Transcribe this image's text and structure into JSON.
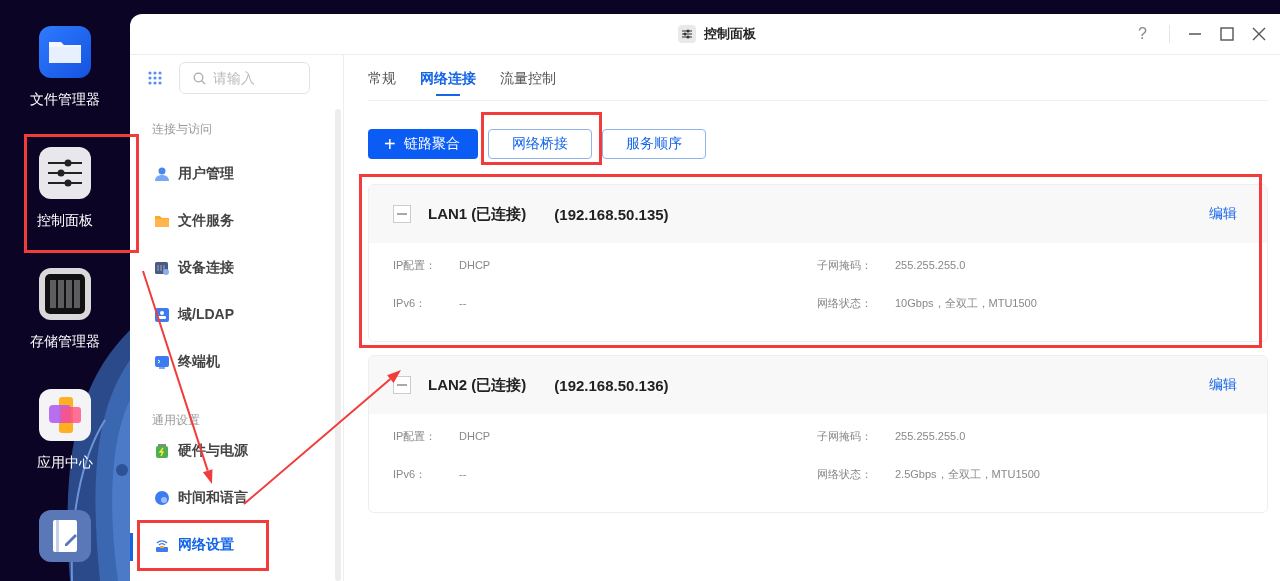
{
  "desktop": {
    "icons": [
      {
        "kind": "folder",
        "label": "文件管理器",
        "highlighted": false
      },
      {
        "kind": "sliders",
        "label": "控制面板",
        "highlighted": true
      },
      {
        "kind": "storage",
        "label": "存储管理器",
        "highlighted": false
      },
      {
        "kind": "apps",
        "label": "应用中心",
        "highlighted": false
      },
      {
        "kind": "notes",
        "highlighted": false
      }
    ]
  },
  "window": {
    "title": "控制面板",
    "help": "?"
  },
  "sidebar": {
    "search": {
      "placeholder": "请输入"
    },
    "sections": [
      {
        "title": "连接与访问",
        "items": [
          {
            "label": "用户管理",
            "selected": false,
            "highlighted": false
          },
          {
            "label": "文件服务",
            "selected": false,
            "highlighted": false
          },
          {
            "label": "设备连接",
            "selected": false,
            "highlighted": false
          },
          {
            "label": "域/LDAP",
            "selected": false,
            "highlighted": false
          },
          {
            "label": "终端机",
            "selected": false,
            "highlighted": false
          }
        ]
      },
      {
        "title": "通用设置",
        "items": [
          {
            "label": "硬件与电源",
            "selected": false,
            "highlighted": false
          },
          {
            "label": "时间和语言",
            "selected": false,
            "highlighted": false
          },
          {
            "label": "网络设置",
            "selected": true,
            "highlighted": true
          }
        ]
      }
    ]
  },
  "tabs": [
    {
      "label": "常规",
      "selected": false
    },
    {
      "label": "网络连接",
      "selected": true
    },
    {
      "label": "流量控制",
      "selected": false
    }
  ],
  "toolbar": [
    {
      "kind": "primary",
      "glyph": "+",
      "label": "链路聚合",
      "highlighted": false
    },
    {
      "kind": "outline",
      "label": "网络桥接",
      "highlighted": true
    },
    {
      "kind": "outline",
      "label": "服务顺序",
      "highlighted": false
    }
  ],
  "interfaces": [
    {
      "name": "LAN1 (已连接)",
      "ip": "(192.168.50.135)",
      "expanded": true,
      "edit": "编辑",
      "highlighted": true,
      "fields": [
        {
          "label": "IP配置：",
          "value": "DHCP"
        },
        {
          "label": "子网掩码：",
          "value": "255.255.255.0"
        },
        {
          "label": "IPv6：",
          "value": "--"
        },
        {
          "label": "网络状态：",
          "value": "10Gbps，全双工，MTU1500"
        }
      ]
    },
    {
      "name": "LAN2 (已连接)",
      "ip": "(192.168.50.136)",
      "expanded": true,
      "edit": "编辑",
      "highlighted": false,
      "fields": [
        {
          "label": "IP配置：",
          "value": "DHCP"
        },
        {
          "label": "子网掩码：",
          "value": "255.255.255.0"
        },
        {
          "label": "IPv6：",
          "value": "--"
        },
        {
          "label": "网络状态：",
          "value": "2.5Gbps，全双工，MTU1500"
        }
      ]
    }
  ]
}
